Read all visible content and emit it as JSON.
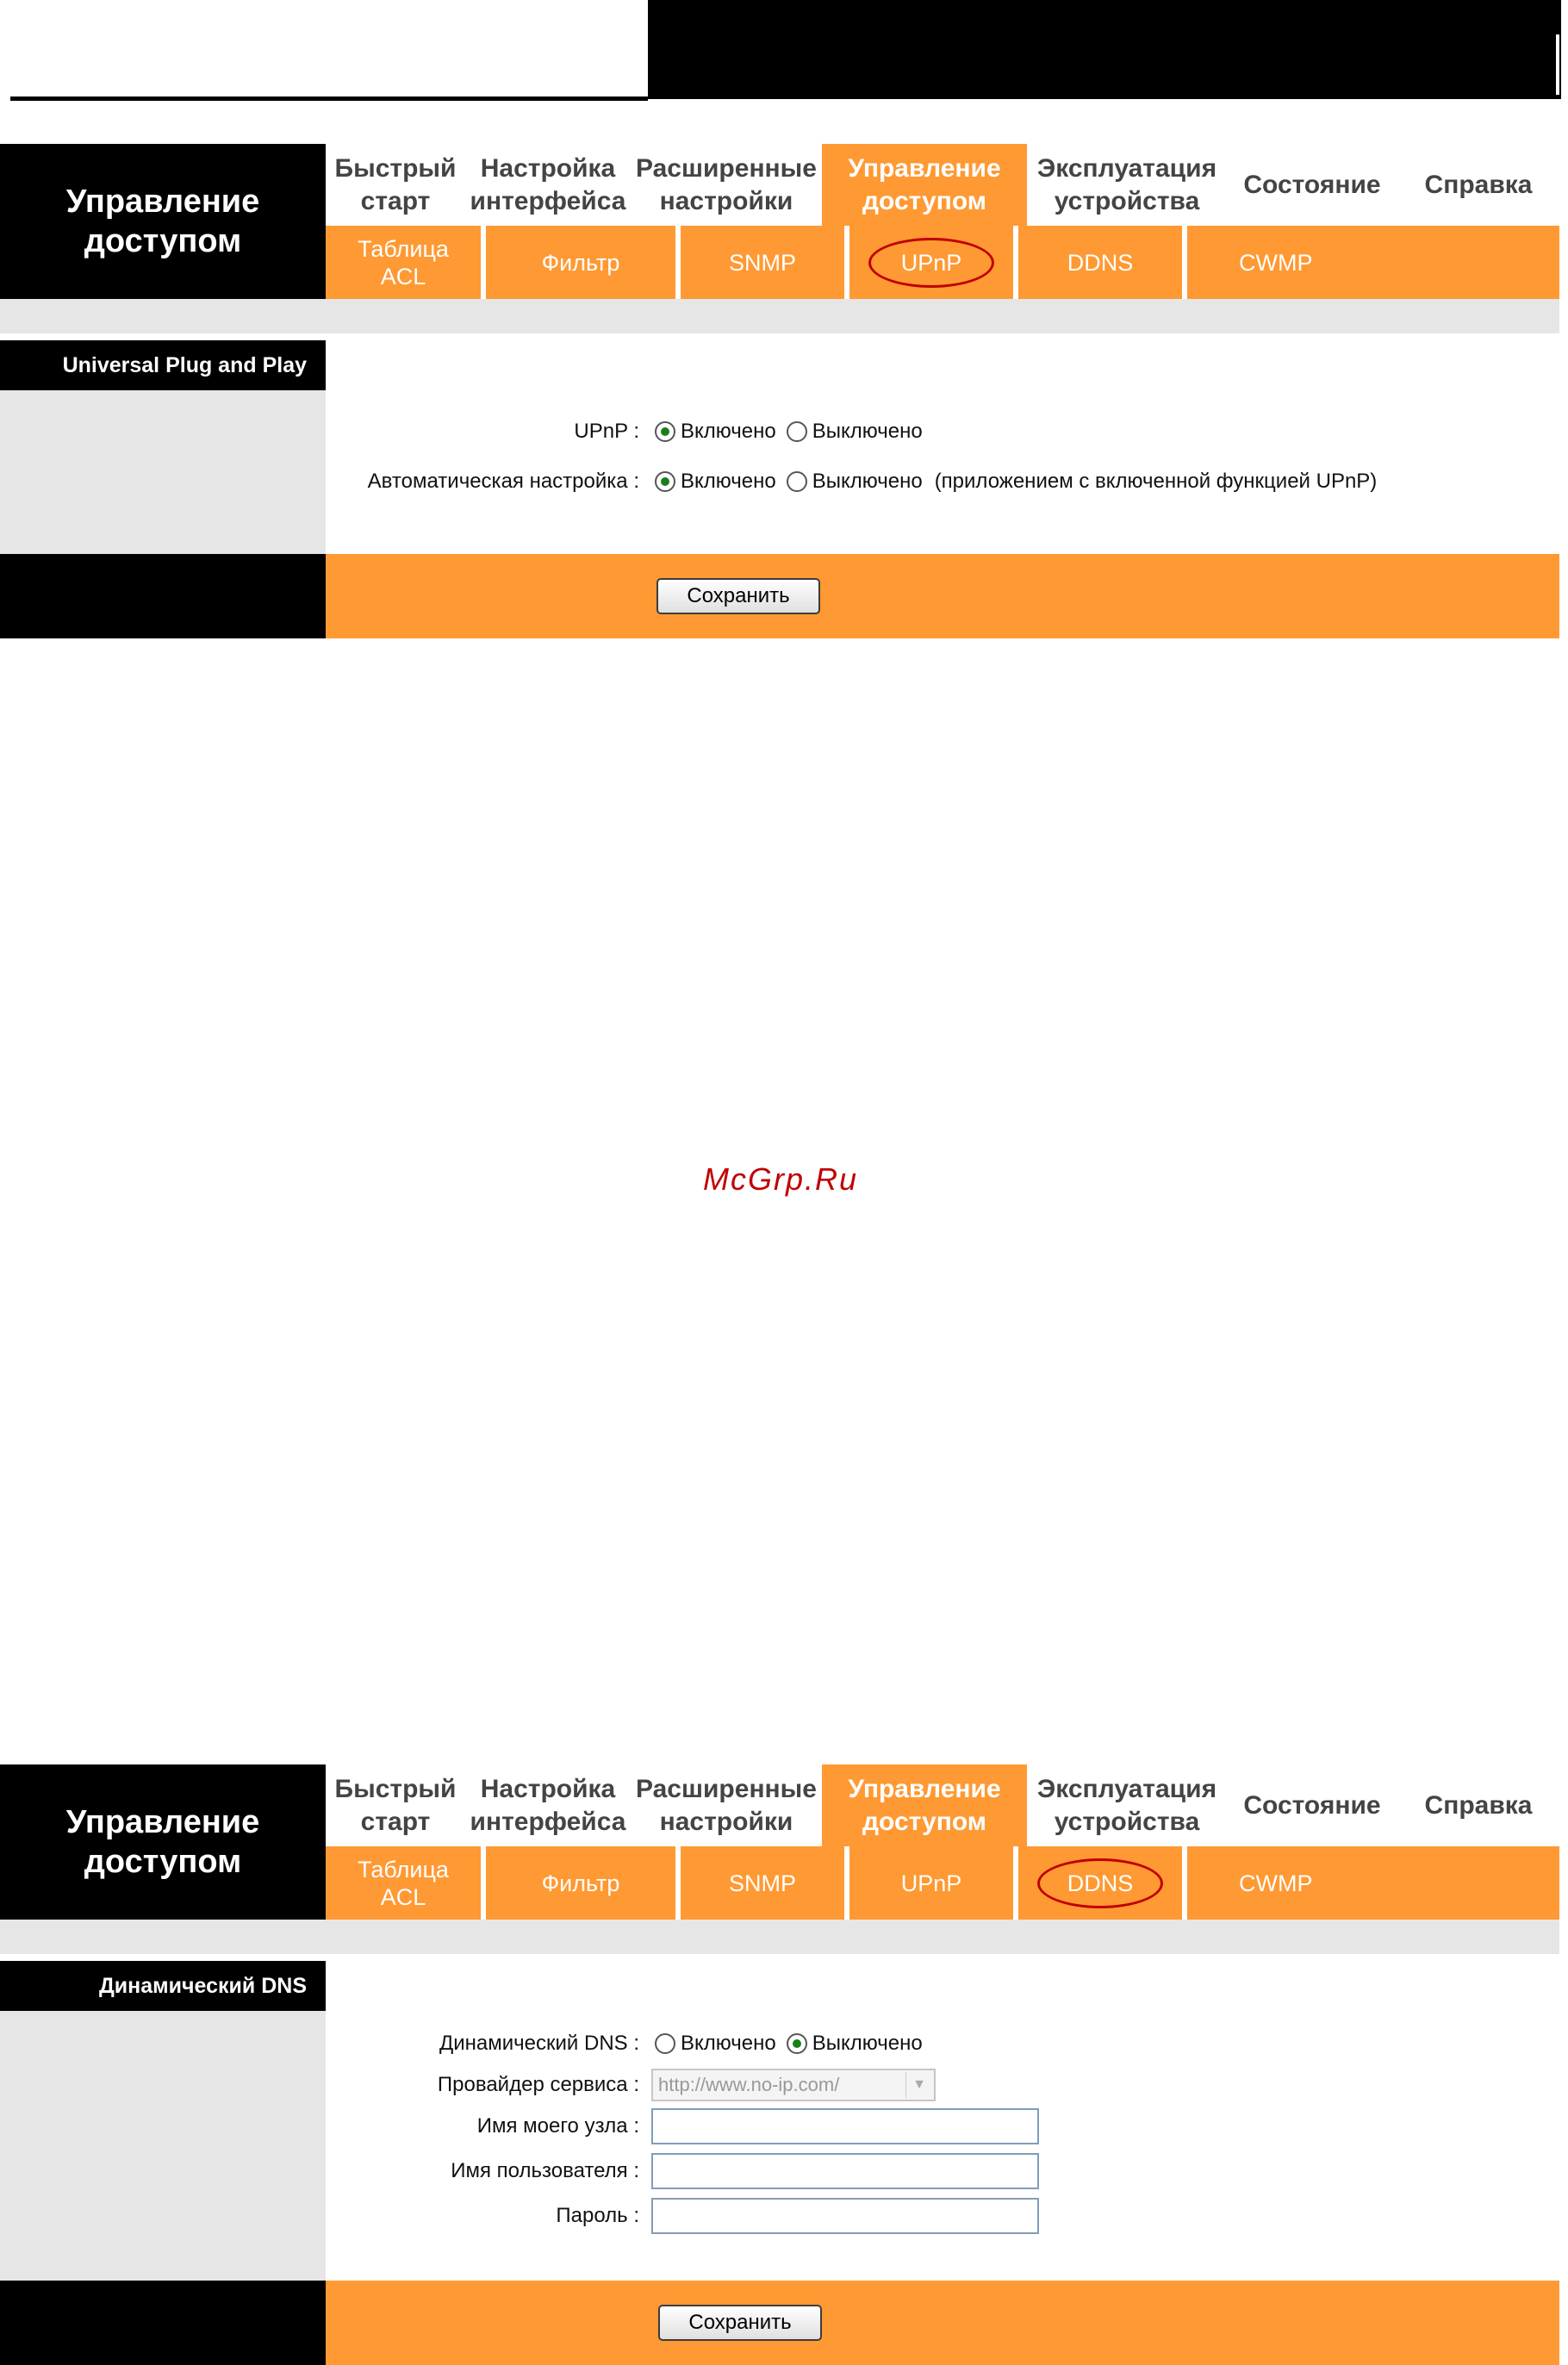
{
  "watermark": "McGrp.Ru",
  "panel1": {
    "brand": "Управление\nдоступом",
    "nav": [
      {
        "label": "Быстрый\nстарт",
        "active": false
      },
      {
        "label": "Настройка\nинтерфейса",
        "active": false
      },
      {
        "label": "Расширенные\nнастройки",
        "active": false
      },
      {
        "label": "Управление\nдоступом",
        "active": true
      },
      {
        "label": "Эксплуатация\nустройства",
        "active": false
      },
      {
        "label": "Состояние",
        "active": false
      },
      {
        "label": "Справка",
        "active": false
      }
    ],
    "subnav": [
      {
        "label": "Таблица\nACL",
        "highlighted": false
      },
      {
        "label": "Фильтр",
        "highlighted": false
      },
      {
        "label": "SNMP",
        "highlighted": false
      },
      {
        "label": "UPnP",
        "highlighted": true
      },
      {
        "label": "DDNS",
        "highlighted": false
      },
      {
        "label": "CWMP",
        "highlighted": false
      }
    ],
    "section_title": "Universal Plug and Play",
    "upnp_label": "UPnP :",
    "auto_label": "Автоматическая настройка :",
    "opt_on": "Включено",
    "opt_off": "Выключено",
    "auto_note": "(приложением с включенной функцией UPnP)",
    "upnp_selected": "on",
    "auto_selected": "on",
    "save": "Сохранить"
  },
  "panel2": {
    "brand": "Управление\nдоступом",
    "nav": [
      {
        "label": "Быстрый\nстарт",
        "active": false
      },
      {
        "label": "Настройка\nинтерфейса",
        "active": false
      },
      {
        "label": "Расширенные\nнастройки",
        "active": false
      },
      {
        "label": "Управление\nдоступом",
        "active": true
      },
      {
        "label": "Эксплуатация\nустройства",
        "active": false
      },
      {
        "label": "Состояние",
        "active": false
      },
      {
        "label": "Справка",
        "active": false
      }
    ],
    "subnav": [
      {
        "label": "Таблица\nACL",
        "highlighted": false
      },
      {
        "label": "Фильтр",
        "highlighted": false
      },
      {
        "label": "SNMP",
        "highlighted": false
      },
      {
        "label": "UPnP",
        "highlighted": false
      },
      {
        "label": "DDNS",
        "highlighted": true
      },
      {
        "label": "CWMP",
        "highlighted": false
      }
    ],
    "section_title": "Динамический DNS",
    "ddns_label": "Динамический DNS :",
    "provider_label": "Провайдер сервиса :",
    "provider_value": "http://www.no-ip.com/",
    "host_label": "Имя моего узла :",
    "user_label": "Имя пользователя :",
    "pass_label": "Пароль :",
    "opt_on": "Включено",
    "opt_off": "Выключено",
    "ddns_selected": "off",
    "save": "Сохранить"
  }
}
